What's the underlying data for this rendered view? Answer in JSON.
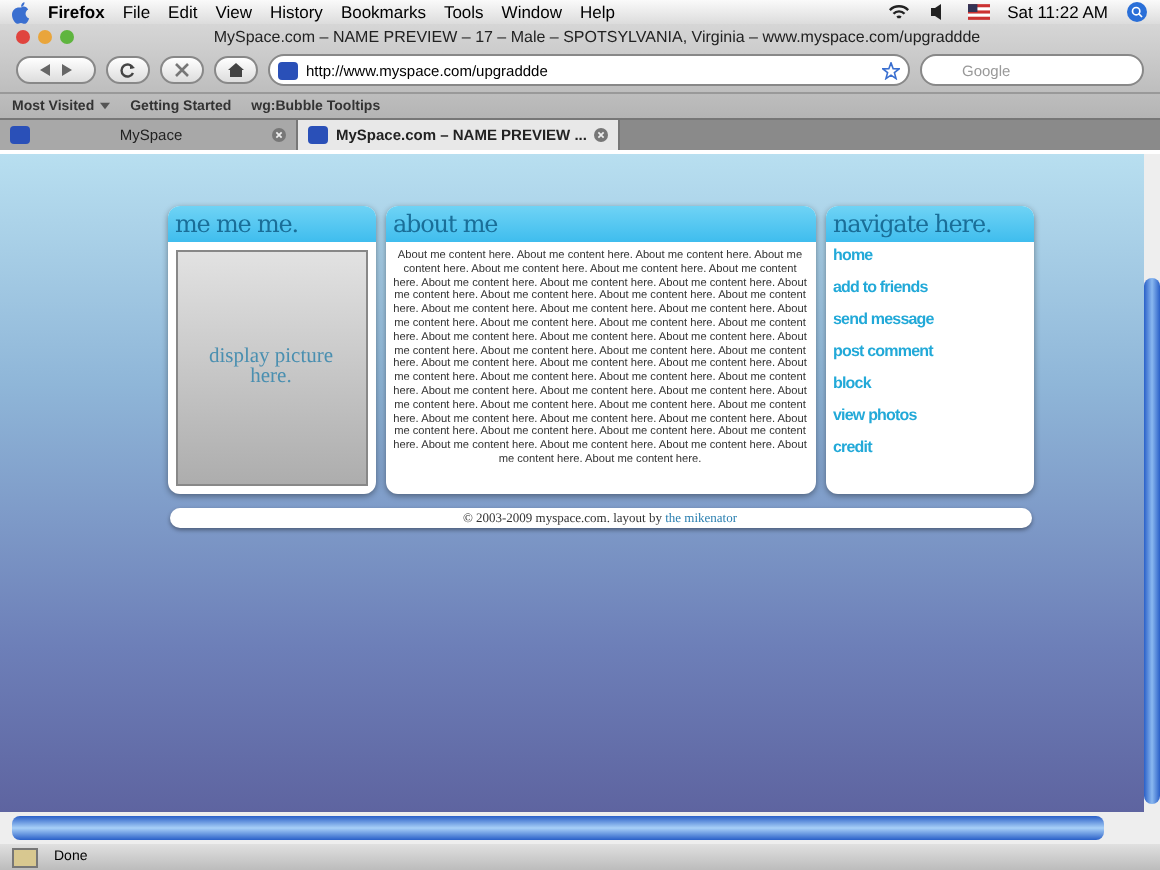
{
  "menubar": {
    "app": "Firefox",
    "menus": [
      "File",
      "Edit",
      "View",
      "History",
      "Bookmarks",
      "Tools",
      "Window",
      "Help"
    ],
    "clock": "Sat 11:22 AM"
  },
  "window": {
    "title": "MySpace.com – NAME PREVIEW – 17 – Male – SPOTSYLVANIA, Virginia – www.myspace.com/upgraddde",
    "url": "http://www.myspace.com/upgraddde",
    "search_placeholder": "Google"
  },
  "bookmarks": [
    {
      "label": "Most Visited",
      "menu": true
    },
    {
      "label": "Getting Started",
      "menu": false
    },
    {
      "label": "wg:Bubble Tooltips",
      "menu": false
    }
  ],
  "tabs": [
    {
      "label": "MySpace",
      "selected": false
    },
    {
      "label": "MySpace.com – NAME PREVIEW ...",
      "selected": true
    }
  ],
  "profile": {
    "photo_header": "me me me.",
    "photo_placeholder": "display picture here.",
    "about_header": "about me",
    "about_text": "About me content here. About me content here. About me content here. About me content here. About me content here. About me content here. About me content here. About me content here. About me content here. About me content here. About me content here. About me content here. About me content here. About me content here. About me content here. About me content here. About me content here. About me content here. About me content here. About me content here. About me content here. About me content here. About me content here. About me content here. About me content here. About me content here. About me content here. About me content here. About me content here. About me content here. About me content here. About me content here. About me content here. About me content here. About me content here. About me content here. About me content here. About me content here. About me content here. About me content here. About me content here. About me content here. About me content here. About me content here. About me content here. About me content here. About me content here. About me content here. About me content here. About me content here. About me content here. About me content here. About me content here. About me content here.",
    "nav_header": "navigate here.",
    "nav_links": [
      "home",
      "add to friends",
      "send message",
      "post comment",
      "block",
      "view photos",
      "credit"
    ],
    "footer_text": "© 2003-2009 myspace.com. layout by",
    "footer_link": "the mikenator"
  },
  "status": "Done"
}
